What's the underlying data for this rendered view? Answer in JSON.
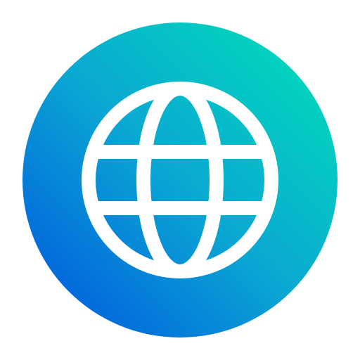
{
  "icon": {
    "name": "globe-icon",
    "colors": {
      "gradient_light": "#00e3b6",
      "gradient_dark": "#0051e0",
      "stroke": "#ffffff"
    }
  }
}
